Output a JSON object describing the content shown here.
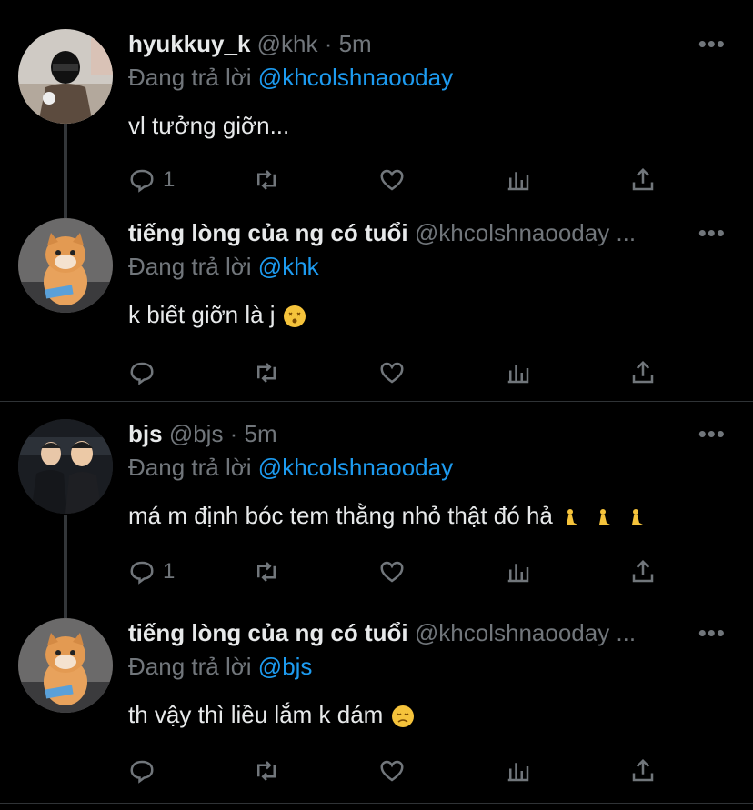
{
  "tweets": [
    {
      "name": "hyukkuy_k",
      "handle_time": "@khk · 5m",
      "reply_prefix": "Đang trả lời",
      "reply_handle": "@khcolshnaooday",
      "text": "vl tưởng giỡn...",
      "reply_count": "1"
    },
    {
      "name": "tiếng lòng của ng có tuổi",
      "handle_time": "@khcolshnaooday ...",
      "reply_prefix": "Đang trả lời",
      "reply_handle": "@khk",
      "text": "k biết giỡn là j",
      "reply_count": ""
    },
    {
      "name": "bjs",
      "handle_time": "@bjs · 5m",
      "reply_prefix": "Đang trả lời",
      "reply_handle": "@khcolshnaooday",
      "text": "má m định bóc tem thằng nhỏ thật đó hả",
      "reply_count": "1"
    },
    {
      "name": "tiếng lòng của ng có tuổi",
      "handle_time": "@khcolshnaooday ...",
      "reply_prefix": "Đang trả lời",
      "reply_handle": "@bjs",
      "text": "th vậy thì liều lắm k dám",
      "reply_count": ""
    }
  ],
  "more_label": "•••",
  "colors": {
    "accent": "#1d9bf0",
    "muted": "#71767b",
    "background": "#000000"
  },
  "icons": [
    "reply-icon",
    "retweet-icon",
    "like-icon",
    "analytics-icon",
    "share-icon",
    "more-icon"
  ]
}
